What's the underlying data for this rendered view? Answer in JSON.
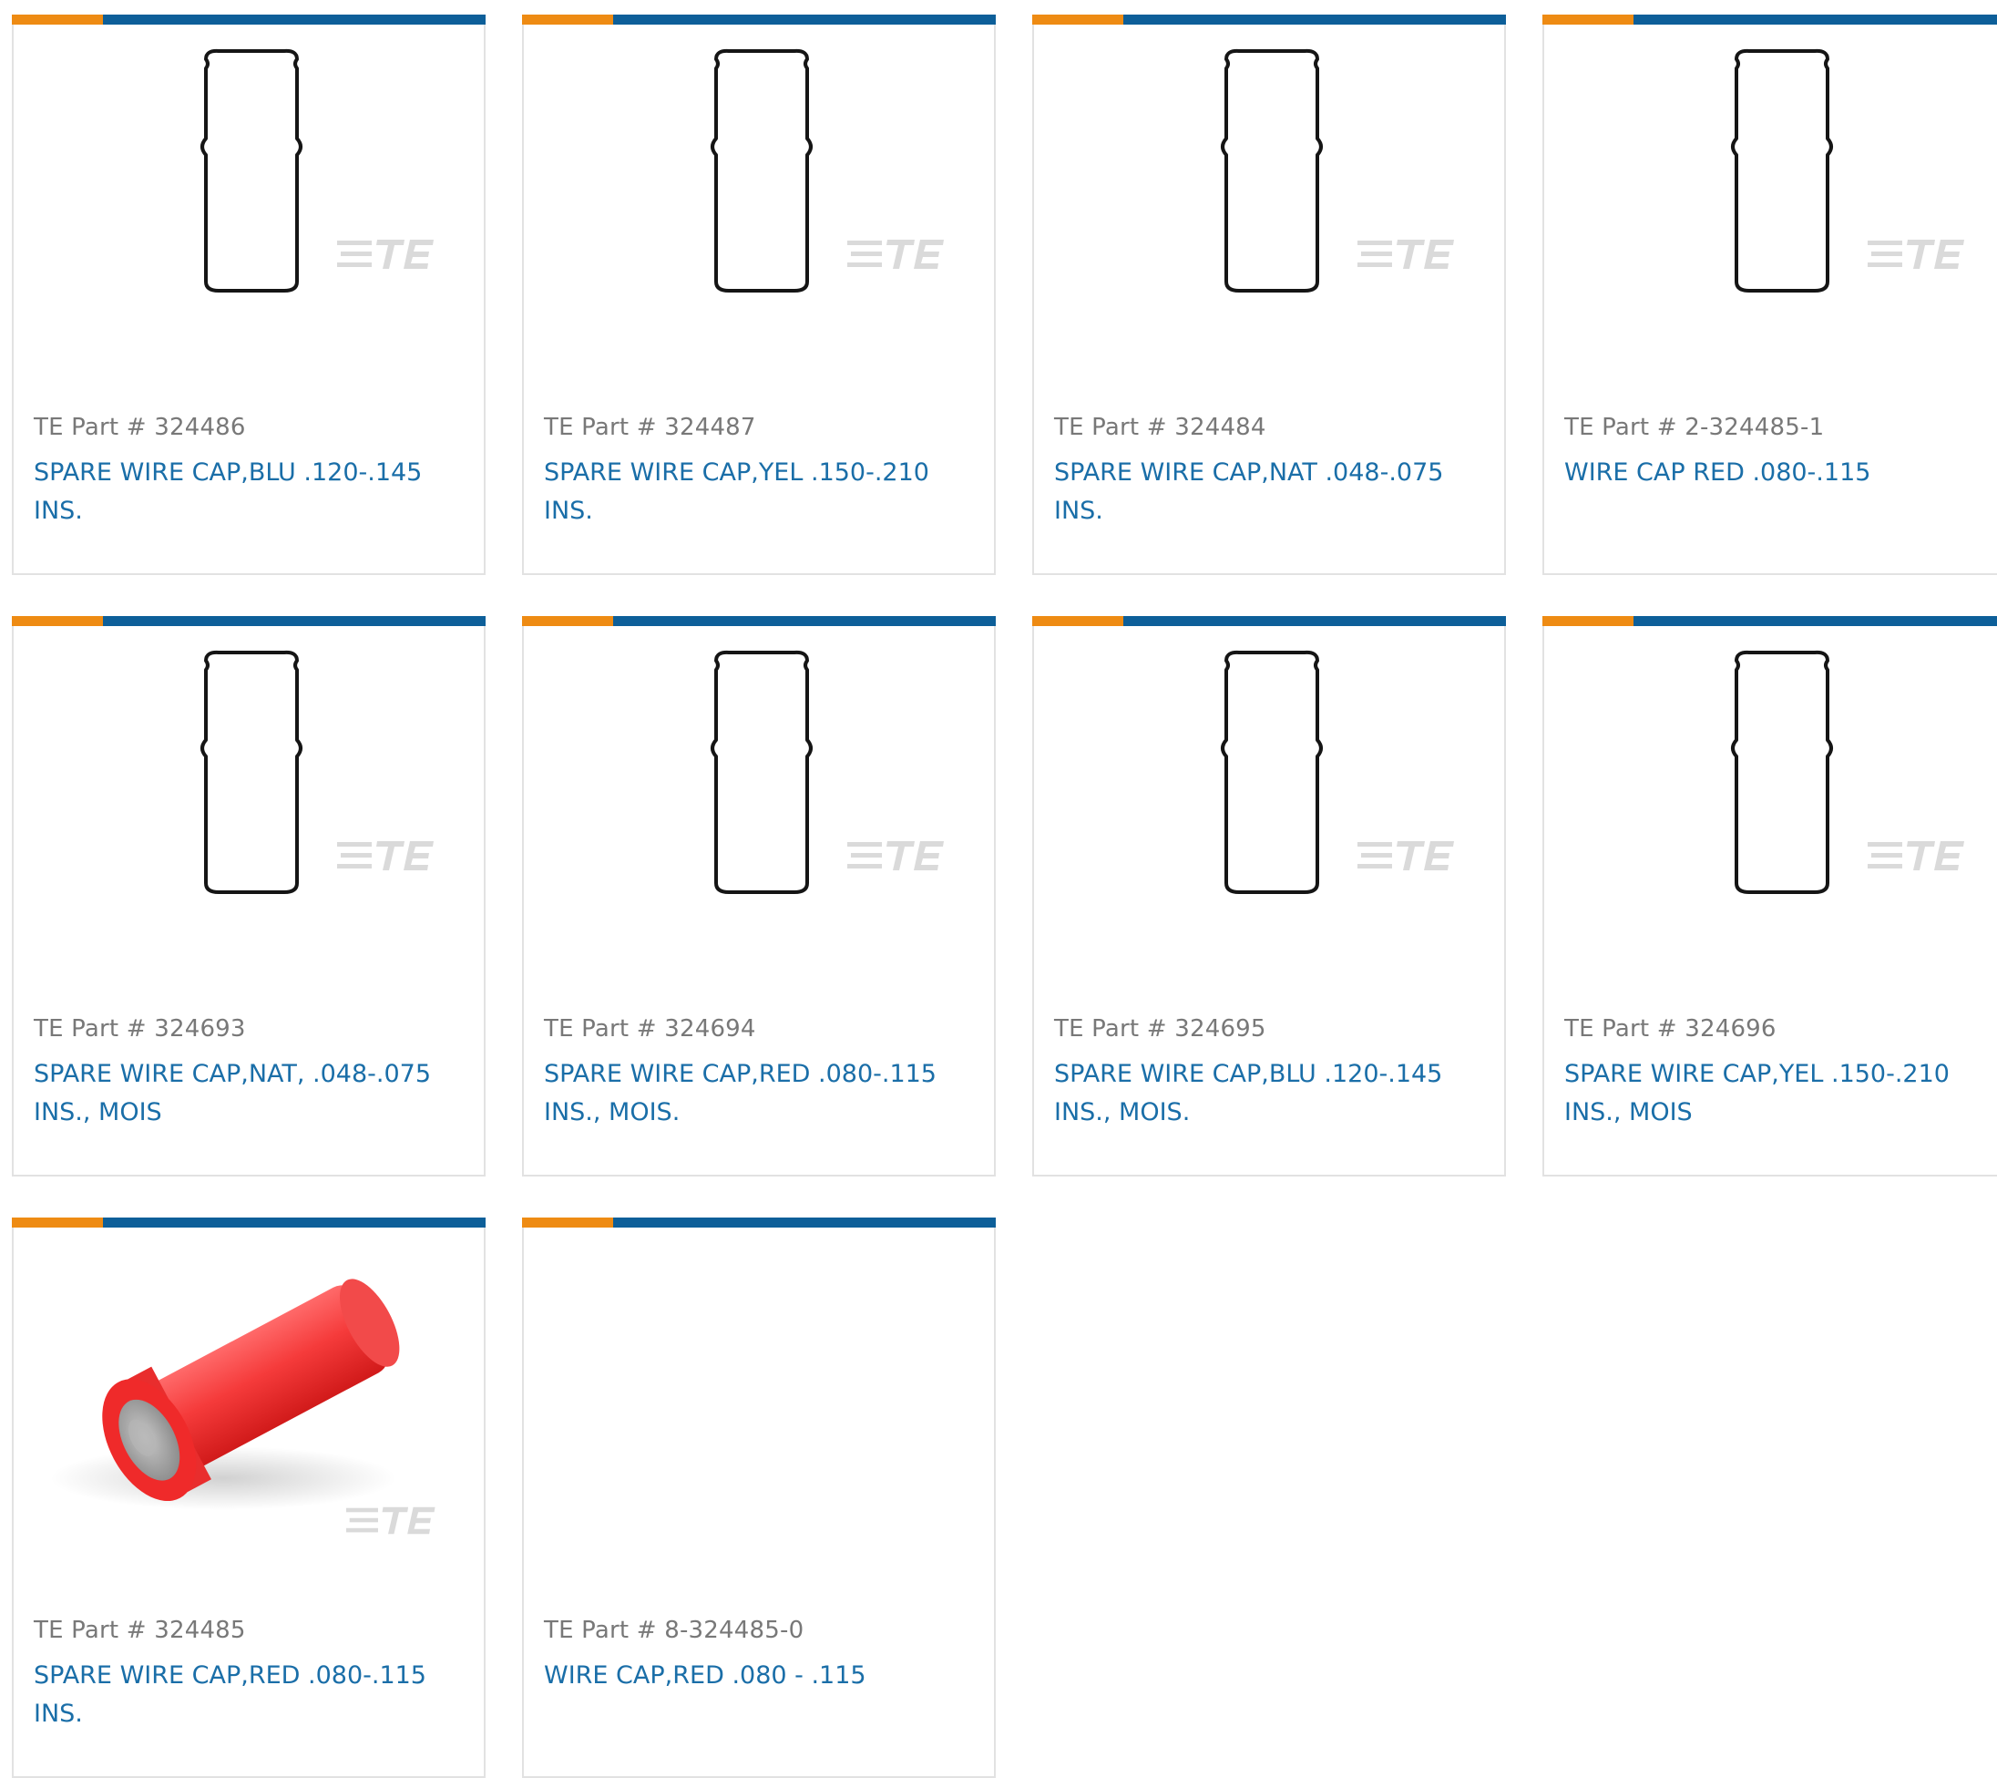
{
  "colors": {
    "accent_orange": "#ee8b13",
    "accent_blue": "#0d5f99",
    "part_number_text": "#787878",
    "description_link": "#1a6ea8",
    "card_border": "#e2e2e2"
  },
  "products": [
    {
      "part_label": "TE Part # 324486",
      "description": "SPARE WIRE CAP,BLU .120-.145 INS.",
      "image": "wire-cap-outline-drawing"
    },
    {
      "part_label": "TE Part # 324487",
      "description": "SPARE WIRE CAP,YEL .150-.210 INS.",
      "image": "wire-cap-outline-drawing"
    },
    {
      "part_label": "TE Part # 324484",
      "description": "SPARE WIRE CAP,NAT .048-.075 INS.",
      "image": "wire-cap-outline-drawing"
    },
    {
      "part_label": "TE Part # 2-324485-1",
      "description": "WIRE CAP RED .080-.115",
      "image": "wire-cap-outline-drawing"
    },
    {
      "part_label": "TE Part # 324693",
      "description": "SPARE WIRE CAP,NAT, .048-.075 INS., MOIS",
      "image": "wire-cap-outline-drawing"
    },
    {
      "part_label": "TE Part # 324694",
      "description": "SPARE WIRE CAP,RED .080-.115 INS., MOIS.",
      "image": "wire-cap-outline-drawing"
    },
    {
      "part_label": "TE Part # 324695",
      "description": "SPARE WIRE CAP,BLU .120-.145 INS., MOIS.",
      "image": "wire-cap-outline-drawing"
    },
    {
      "part_label": "TE Part # 324696",
      "description": "SPARE WIRE CAP,YEL .150-.210 INS., MOIS",
      "image": "wire-cap-outline-drawing"
    },
    {
      "part_label": "TE Part # 324485",
      "description": "SPARE WIRE CAP,RED .080-.115 INS.",
      "image": "red-wire-cap-photo"
    },
    {
      "part_label": "TE Part # 8-324485-0",
      "description": "WIRE CAP,RED .080 - .115",
      "image": "none"
    }
  ]
}
